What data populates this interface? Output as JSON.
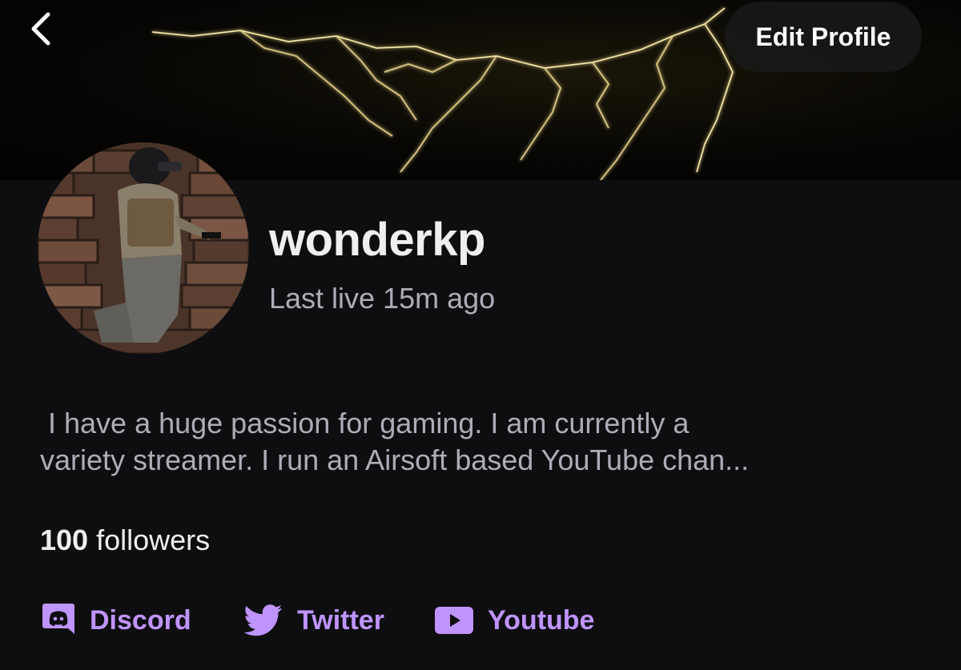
{
  "header": {
    "back_icon": "chevron-left-icon",
    "edit_profile_label": "Edit Profile"
  },
  "profile": {
    "username": "wonderkp",
    "last_live": "Last live 15m ago",
    "bio_lines": [
      " I have a huge passion for gaming. I am currently a",
      "variety streamer. I run an Airsoft based YouTube chan..."
    ],
    "followers_count": "100",
    "followers_label": "followers"
  },
  "social_links": [
    {
      "label": "Discord",
      "icon": "discord-icon"
    },
    {
      "label": "Twitter",
      "icon": "twitter-icon"
    },
    {
      "label": "Youtube",
      "icon": "youtube-icon"
    }
  ],
  "colors": {
    "accent": "#bf94ff",
    "background": "#0e0e10",
    "text_primary": "#efeff1",
    "text_secondary": "#adadb8"
  }
}
